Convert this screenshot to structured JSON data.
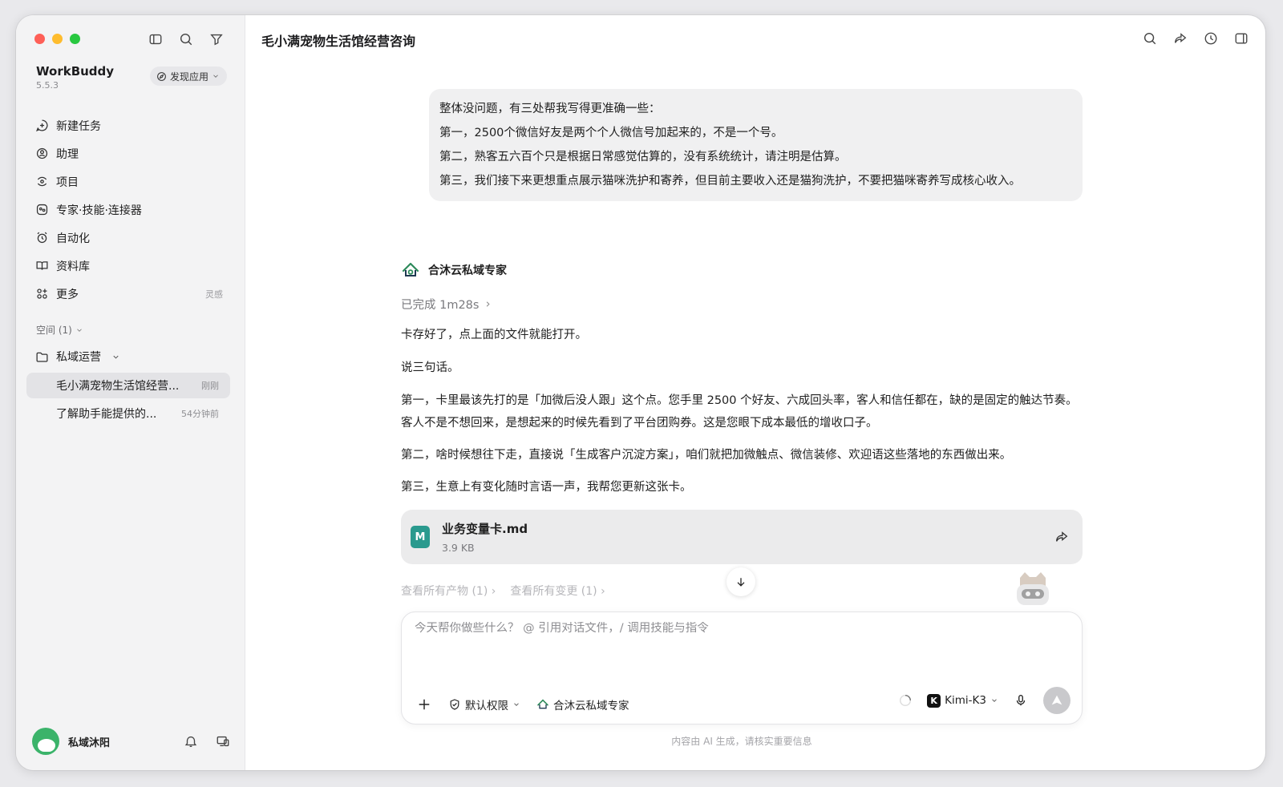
{
  "app": {
    "name": "WorkBuddy",
    "version": "5.5.3",
    "discover_label": "发现应用"
  },
  "nav": [
    {
      "label": "新建任务",
      "hint": ""
    },
    {
      "label": "助理",
      "hint": ""
    },
    {
      "label": "项目",
      "hint": ""
    },
    {
      "label": "专家·技能·连接器",
      "hint": ""
    },
    {
      "label": "自动化",
      "hint": ""
    },
    {
      "label": "资料库",
      "hint": ""
    },
    {
      "label": "更多",
      "hint": "灵感"
    }
  ],
  "spaces": {
    "label": "空间 (1)",
    "folder": "私域运营",
    "sessions": [
      {
        "title": "毛小满宠物生活馆经营...",
        "time": "刚刚"
      },
      {
        "title": "了解助手能提供的...",
        "time": "54分钟前"
      }
    ]
  },
  "user": {
    "name": "私域沐阳"
  },
  "chat": {
    "title": "毛小满宠物生活馆经营咨询",
    "user_message": [
      "整体没问题，有三处帮我写得更准确一些：",
      "第一，2500个微信好友是两个个人微信号加起来的，不是一个号。",
      "第二，熟客五六百个只是根据日常感觉估算的，没有系统统计，请注明是估算。",
      "第三，我们接下来更想重点展示猫咪洗护和寄养，但目前主要收入还是猫狗洗护，不要把猫咪寄养写成核心收入。"
    ],
    "agent_name": "合沐云私域专家",
    "status": "已完成 1m28s",
    "reply": [
      "卡存好了，点上面的文件就能打开。",
      "说三句话。",
      "第一，卡里最该先打的是「加微后没人跟」这个点。您手里 2500 个好友、六成回头率，客人和信任都在，缺的是固定的触达节奏。客人不是不想回来，是想起来的时候先看到了平台团购券。这是您眼下成本最低的增收口子。",
      "第二，啥时候想往下走，直接说「生成客户沉淀方案」，咱们就把加微触点、微信装修、欢迎语这些落地的东西做出来。",
      "第三，生意上有变化随时言语一声，我帮您更新这张卡。"
    ],
    "file": {
      "icon_letter": "M",
      "name": "业务变量卡.md",
      "size": "3.9 KB"
    },
    "links": [
      "查看所有产物 (1)",
      "查看所有变更 (1)"
    ]
  },
  "composer": {
    "placeholder": "今天帮你做些什么？ @ 引用对话文件，/ 调用技能与指令",
    "permission": "默认权限",
    "agent": "合沐云私域专家",
    "model_letter": "K",
    "model": "Kimi-K3"
  },
  "disclaimer": "内容由 AI 生成，请核实重要信息"
}
